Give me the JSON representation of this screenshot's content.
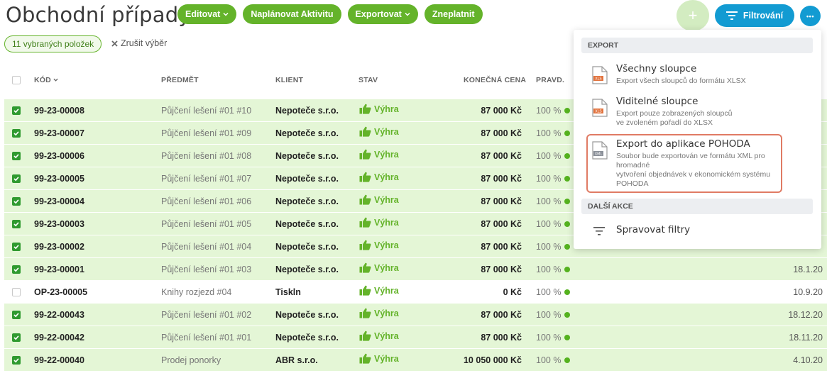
{
  "page": {
    "title": "Obchodní případy"
  },
  "toolbar": {
    "edit_label": "Editovat",
    "plan_label": "Naplánovat Aktivitu",
    "export_label": "Exportovat",
    "invalidate_label": "Zneplatnit",
    "add_label": "+",
    "filter_label": "Filtrování",
    "more_label": "•••"
  },
  "selection": {
    "count_label": "11 vybraných položek",
    "cancel_label": "Zrušit výběr"
  },
  "table": {
    "columns": {
      "code": "KÓD",
      "subject": "PŘEDMĚT",
      "client": "KLIENT",
      "status": "STAV",
      "price": "KONEČNÁ CENA",
      "probability": "PRAVD."
    },
    "rows": [
      {
        "selected": true,
        "code": "99-23-00008",
        "subject": "Půjčení lešení #01 #10",
        "client": "Nepoteče s.r.o.",
        "status": "Výhra",
        "price": "87 000 Kč",
        "probability": "100 %",
        "date": ""
      },
      {
        "selected": true,
        "code": "99-23-00007",
        "subject": "Půjčení lešení #01 #09",
        "client": "Nepoteče s.r.o.",
        "status": "Výhra",
        "price": "87 000 Kč",
        "probability": "100 %",
        "date": ""
      },
      {
        "selected": true,
        "code": "99-23-00006",
        "subject": "Půjčení lešení #01 #08",
        "client": "Nepoteče s.r.o.",
        "status": "Výhra",
        "price": "87 000 Kč",
        "probability": "100 %",
        "date": ""
      },
      {
        "selected": true,
        "code": "99-23-00005",
        "subject": "Půjčení lešení #01 #07",
        "client": "Nepoteče s.r.o.",
        "status": "Výhra",
        "price": "87 000 Kč",
        "probability": "100 %",
        "date": ""
      },
      {
        "selected": true,
        "code": "99-23-00004",
        "subject": "Půjčení lešení #01 #06",
        "client": "Nepoteče s.r.o.",
        "status": "Výhra",
        "price": "87 000 Kč",
        "probability": "100 %",
        "date": ""
      },
      {
        "selected": true,
        "code": "99-23-00003",
        "subject": "Půjčení lešení #01 #05",
        "client": "Nepoteče s.r.o.",
        "status": "Výhra",
        "price": "87 000 Kč",
        "probability": "100 %",
        "date": ""
      },
      {
        "selected": true,
        "code": "99-23-00002",
        "subject": "Půjčení lešení #01 #04",
        "client": "Nepoteče s.r.o.",
        "status": "Výhra",
        "price": "87 000 Kč",
        "probability": "100 %",
        "date": ""
      },
      {
        "selected": true,
        "code": "99-23-00001",
        "subject": "Půjčení lešení #01 #03",
        "client": "Nepoteče s.r.o.",
        "status": "Výhra",
        "price": "87 000 Kč",
        "probability": "100 %",
        "date": "18.1.20"
      },
      {
        "selected": false,
        "code": "OP-23-00005",
        "subject": "Knihy rozjezd #04",
        "client": "Tiskln",
        "status": "Výhra",
        "price": "0 Kč",
        "probability": "100 %",
        "date": "10.9.20"
      },
      {
        "selected": true,
        "code": "99-22-00043",
        "subject": "Půjčení lešení #01 #02",
        "client": "Nepoteče s.r.o.",
        "status": "Výhra",
        "price": "87 000 Kč",
        "probability": "100 %",
        "date": "18.12.20"
      },
      {
        "selected": true,
        "code": "99-22-00042",
        "subject": "Půjčení lešení #01 #01",
        "client": "Nepoteče s.r.o.",
        "status": "Výhra",
        "price": "87 000 Kč",
        "probability": "100 %",
        "date": "18.11.20"
      },
      {
        "selected": true,
        "code": "99-22-00040",
        "subject": "Prodej ponorky",
        "client": "ABR s.r.o.",
        "status": "Výhra",
        "price": "10 050 000 Kč",
        "probability": "100 %",
        "date": "4.10.20"
      }
    ]
  },
  "menu": {
    "export_section": "EXPORT",
    "all_columns": {
      "title": "Všechny sloupce",
      "desc": "Export všech sloupců do formátu XLSX",
      "icon_label": "XLS"
    },
    "visible_columns": {
      "title": "Viditelné sloupce",
      "desc1": "Export pouze zobrazených sloupců",
      "desc2": "ve zvoleném pořadí do XLSX",
      "icon_label": "XLS"
    },
    "pohoda": {
      "title": "Export do aplikace POHODA",
      "desc1": "Soubor bude exportován ve formátu XML pro",
      "desc2": "hromadné",
      "desc3": "vytvoření objednávek v ekonomickém systému",
      "desc4": "POHODA",
      "icon_label": "XML"
    },
    "more_section": "DALŠÍ AKCE",
    "manage_filters": "Spravovat filtry"
  },
  "colors": {
    "primary_green": "#64b32a",
    "primary_blue": "#129bd2",
    "selected_row": "#e4f6d6",
    "highlight": "#e07b64"
  }
}
